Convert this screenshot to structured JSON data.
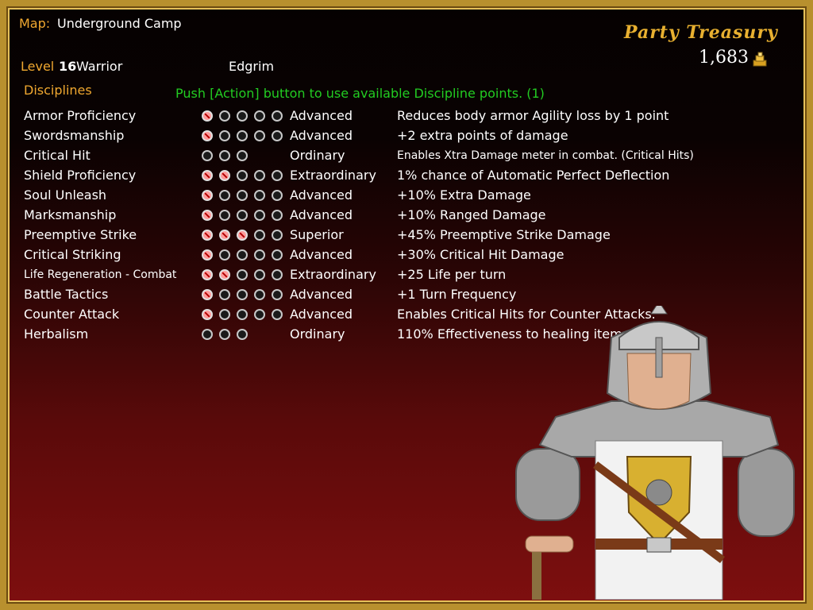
{
  "map": {
    "label": "Map:",
    "name": "Underground Camp"
  },
  "character": {
    "level_label": "Level",
    "level": "16",
    "class": "Warrior",
    "name": "Edgrim"
  },
  "treasury": {
    "title": "Party Treasury",
    "amount": "1,683",
    "icon": "gold-pile-icon"
  },
  "disciplines_label": "Disciplines",
  "instruction": "Push [Action] button to use available Discipline points.  (1)",
  "colors": {
    "gold": "#f0a830",
    "green": "#22cc22",
    "white": "#ffffff",
    "frame": "#b8902e"
  },
  "disciplines": [
    {
      "name": "Armor Proficiency",
      "pips": 5,
      "filled": 1,
      "rank": "Advanced",
      "desc": "Reduces body armor Agility loss by 1 point"
    },
    {
      "name": "Swordsmanship",
      "pips": 5,
      "filled": 1,
      "rank": "Advanced",
      "desc": "+2 extra points of damage"
    },
    {
      "name": "Critical Hit",
      "pips": 3,
      "filled": 0,
      "rank": "Ordinary",
      "desc": "Enables Xtra Damage meter in combat. (Critical Hits)"
    },
    {
      "name": "Shield Proficiency",
      "pips": 5,
      "filled": 2,
      "rank": "Extraordinary",
      "desc": "1% chance of Automatic Perfect Deflection"
    },
    {
      "name": "Soul Unleash",
      "pips": 5,
      "filled": 1,
      "rank": "Advanced",
      "desc": "+10% Extra Damage"
    },
    {
      "name": "Marksmanship",
      "pips": 5,
      "filled": 1,
      "rank": "Advanced",
      "desc": "+10% Ranged Damage"
    },
    {
      "name": "Preemptive Strike",
      "pips": 5,
      "filled": 3,
      "rank": "Superior",
      "desc": "+45% Preemptive Strike Damage"
    },
    {
      "name": "Critical Striking",
      "pips": 5,
      "filled": 1,
      "rank": "Advanced",
      "desc": "+30% Critical Hit Damage"
    },
    {
      "name": "Life Regeneration - Combat",
      "pips": 5,
      "filled": 2,
      "rank": "Extraordinary",
      "desc": "+25 Life per turn"
    },
    {
      "name": "Battle Tactics",
      "pips": 5,
      "filled": 1,
      "rank": "Advanced",
      "desc": "+1 Turn Frequency"
    },
    {
      "name": "Counter Attack",
      "pips": 5,
      "filled": 1,
      "rank": "Advanced",
      "desc": "Enables Critical Hits for Counter Attacks."
    },
    {
      "name": "Herbalism",
      "pips": 3,
      "filled": 0,
      "rank": "Ordinary",
      "desc": "110% Effectiveness to healing items"
    }
  ]
}
